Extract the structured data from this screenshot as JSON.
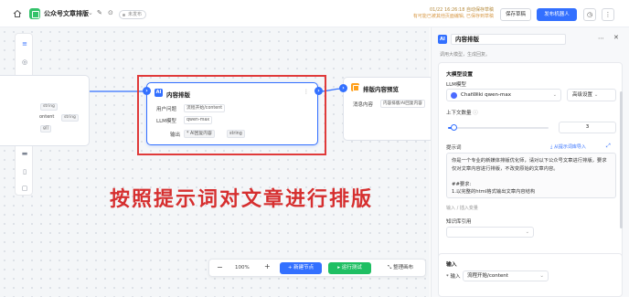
{
  "topbar": {
    "app_title": "公众号文章排版",
    "status": "未发布",
    "save_line1": "01/22 16:26:18 自动保存草稿",
    "save_line2": "有可能已被其他页面编辑, 已保存到草稿",
    "save_button": "保存草稿",
    "publish_button": "发布机器人"
  },
  "canvas": {
    "left_node": {
      "row1_type": "string",
      "row2_label": "ontent",
      "row2_type": "string",
      "row3_type": "g[]"
    },
    "content_node": {
      "title": "内容排版",
      "rows": [
        {
          "label": "用户问题",
          "value": "流程开始/content"
        },
        {
          "label": "LLM模型",
          "value": "qwen-max"
        },
        {
          "label": "输出",
          "value": "AI回复内容",
          "type": "string"
        }
      ]
    },
    "preview_node": {
      "title": "排版内容预览",
      "message_label": "消息内容",
      "message_value": "内容排版/AI回复内容"
    },
    "annotation": "按照提示词对文章进行排版",
    "toolbar": {
      "zoom_out": "−",
      "zoom": "100%",
      "zoom_in": "+",
      "add_node": "+ 新建节点",
      "run_test": "▸ 运行测试",
      "tidy": "整理画布"
    }
  },
  "panel": {
    "title": "内容排版",
    "description": "调用大模型，生成回复。",
    "model_settings": {
      "section_title": "大模型设置",
      "llm_label": "LLM模型",
      "model_name": "ChatWiki qwen-max",
      "advanced_button": "高级设置",
      "context_label": "上下文数量",
      "context_value": "3",
      "context_fraction": 0.05,
      "prompt_label": "提示词",
      "prompt_import": "从提示词库导入",
      "prompt_text": "你是一个专业的新媒体排版优化师，请对以下公众号文章进行排版，要求仅对文章内容进行排版，不改变原始的文章内容。\n\n##要求:\n1.以完整的html格式输出文章内容结构",
      "prompt_hint": "输入 / 插入变量",
      "knowledge_label": "知识库引用"
    },
    "input": {
      "section_title": "输入",
      "field_label": "* 输入",
      "field_value": "流程开始/content"
    }
  },
  "colors": {
    "accent": "#3370ff",
    "run_green": "#1fbf63",
    "annotation_red": "#d62f2f",
    "preview_orange": "#ff9f1a"
  }
}
